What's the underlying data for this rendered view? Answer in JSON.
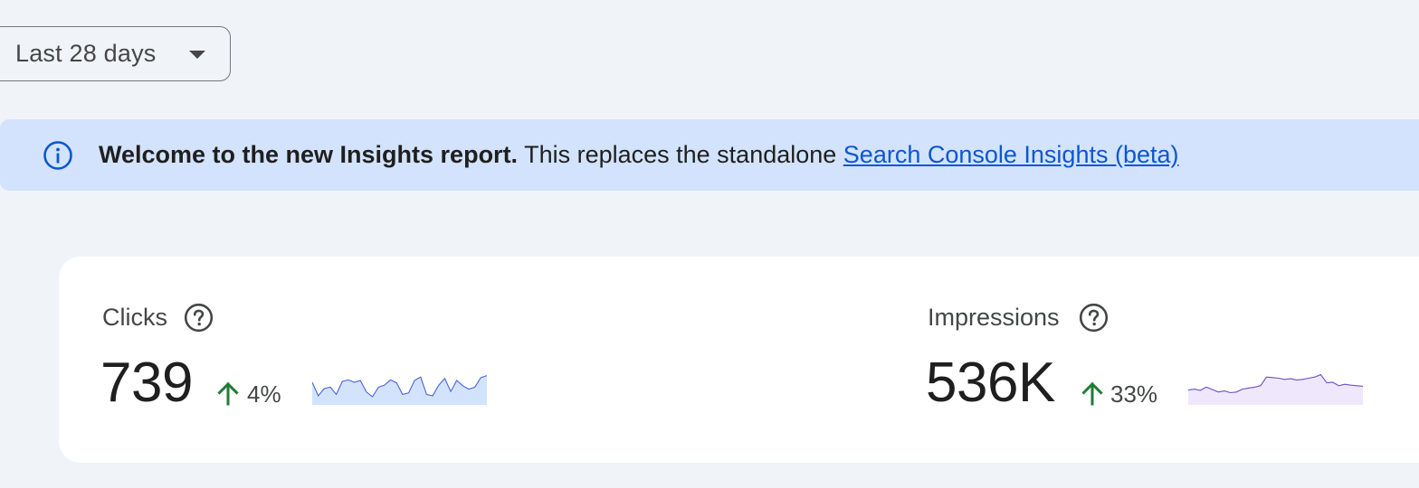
{
  "date_range": {
    "selected": "Last 28 days"
  },
  "banner": {
    "bold_text": "Welcome to the new Insights report.",
    "text": " This replaces the standalone ",
    "link_text": "Search Console Insights (beta)"
  },
  "metrics": [
    {
      "title": "Clicks",
      "value": "739",
      "change": "4%",
      "change_direction": "up",
      "spark_color": "#4a64d6",
      "spark_fill": "#d3e3fd",
      "spark_values": [
        0.72,
        0.25,
        0.5,
        0.55,
        0.3,
        0.75,
        0.8,
        0.72,
        0.78,
        0.38,
        0.22,
        0.55,
        0.62,
        0.8,
        0.7,
        0.3,
        0.35,
        0.78,
        0.9,
        0.3,
        0.25,
        0.62,
        0.85,
        0.4,
        0.78,
        0.6,
        0.48,
        0.55,
        0.88,
        0.95
      ]
    },
    {
      "title": "Impressions",
      "value": "536K",
      "change": "33%",
      "change_direction": "up",
      "spark_color": "#6a4fc8",
      "spark_fill": "#efe7fb",
      "spark_values": [
        0.45,
        0.48,
        0.44,
        0.55,
        0.47,
        0.38,
        0.42,
        0.36,
        0.38,
        0.48,
        0.52,
        0.55,
        0.6,
        0.9,
        0.88,
        0.86,
        0.82,
        0.84,
        0.8,
        0.82,
        0.86,
        0.9,
        0.98,
        0.7,
        0.72,
        0.6,
        0.65,
        0.62,
        0.6,
        0.58
      ]
    }
  ],
  "colors": {
    "positive_arrow": "#1e7d34",
    "link": "#0b57d0",
    "info_icon": "#0b57d0"
  }
}
